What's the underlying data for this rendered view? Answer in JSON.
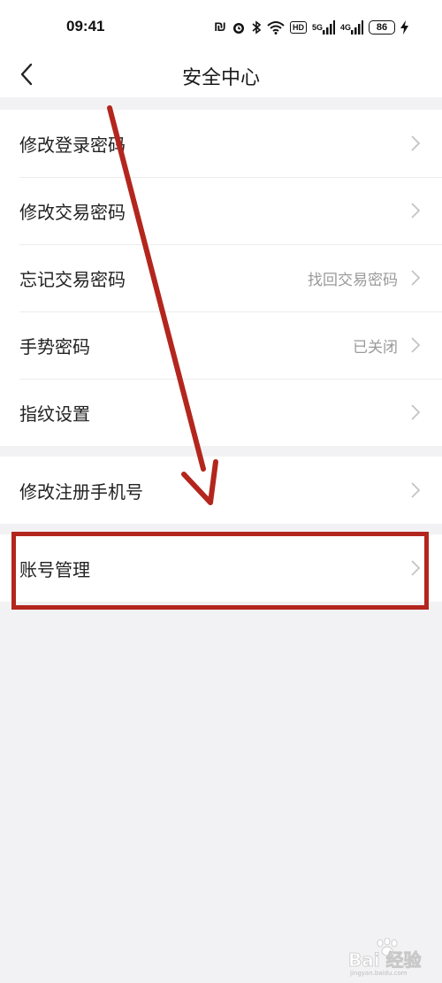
{
  "status_bar": {
    "time": "09:41",
    "network_badge": "HD",
    "signal_1": "5G",
    "signal_2": "4G",
    "battery": "86"
  },
  "header": {
    "title": "安全中心"
  },
  "groups": [
    {
      "items": [
        {
          "label": "修改登录密码",
          "value": ""
        },
        {
          "label": "修改交易密码",
          "value": ""
        },
        {
          "label": "忘记交易密码",
          "value": "找回交易密码"
        },
        {
          "label": "手势密码",
          "value": "已关闭"
        },
        {
          "label": "指纹设置",
          "value": ""
        }
      ]
    },
    {
      "items": [
        {
          "label": "修改注册手机号",
          "value": ""
        }
      ]
    },
    {
      "items": [
        {
          "label": "账号管理",
          "value": ""
        }
      ]
    }
  ],
  "watermark": {
    "text": "Bai 经验",
    "subtext": "jingyan.baidu.com"
  },
  "colors": {
    "annotation": "#b3261e",
    "background": "#f2f2f4",
    "chevron": "#c4c4c4"
  }
}
